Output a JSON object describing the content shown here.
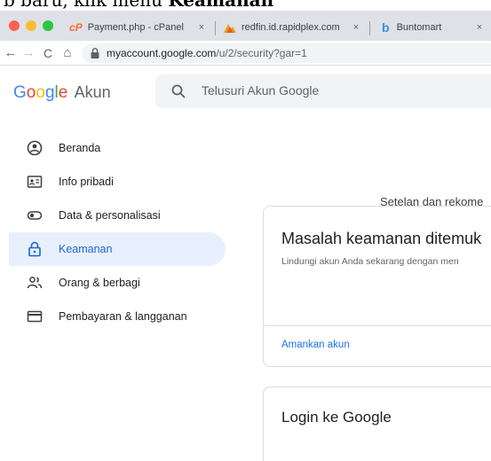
{
  "caption": {
    "prefix": "b baru, klik menu ",
    "bold": "Keamanan"
  },
  "browser": {
    "tabs": [
      {
        "title": "Payment.php - cPanel",
        "close": "×"
      },
      {
        "title": "redfin.id.rapidplex.com",
        "close": "×"
      },
      {
        "title": "Buntomart",
        "close": "×"
      }
    ],
    "nav": {
      "back": "←",
      "forward": "→",
      "reload": "C",
      "home": "⌂"
    },
    "url": {
      "host": "myaccount.google.com",
      "path": "/u/2/security?gar=1"
    }
  },
  "header": {
    "logo": {
      "g1": "G",
      "o1": "o",
      "o2": "o",
      "g2": "g",
      "l": "l",
      "e": "e",
      "suffix": "Akun"
    },
    "search_placeholder": "Telusuri Akun Google"
  },
  "sidebar": {
    "items": [
      {
        "label": "Beranda",
        "icon": "account-circle-icon"
      },
      {
        "label": "Info pribadi",
        "icon": "id-card-icon"
      },
      {
        "label": "Data & personalisasi",
        "icon": "toggle-icon"
      },
      {
        "label": "Keamanan",
        "icon": "lock-icon",
        "active": true
      },
      {
        "label": "Orang & berbagi",
        "icon": "people-icon"
      },
      {
        "label": "Pembayaran & langganan",
        "icon": "credit-card-icon"
      }
    ]
  },
  "main": {
    "subtitle": "Setelan dan rekome",
    "security_card": {
      "title": "Masalah keamanan ditemuk",
      "description": "Lindungi akun Anda sekarang dengan men",
      "action": "Amankan akun"
    },
    "login_card": {
      "title": "Login ke Google"
    }
  },
  "colors": {
    "accent": "#1a73e8",
    "active_bg": "#e8f0fe",
    "active_text": "#1967d2"
  }
}
